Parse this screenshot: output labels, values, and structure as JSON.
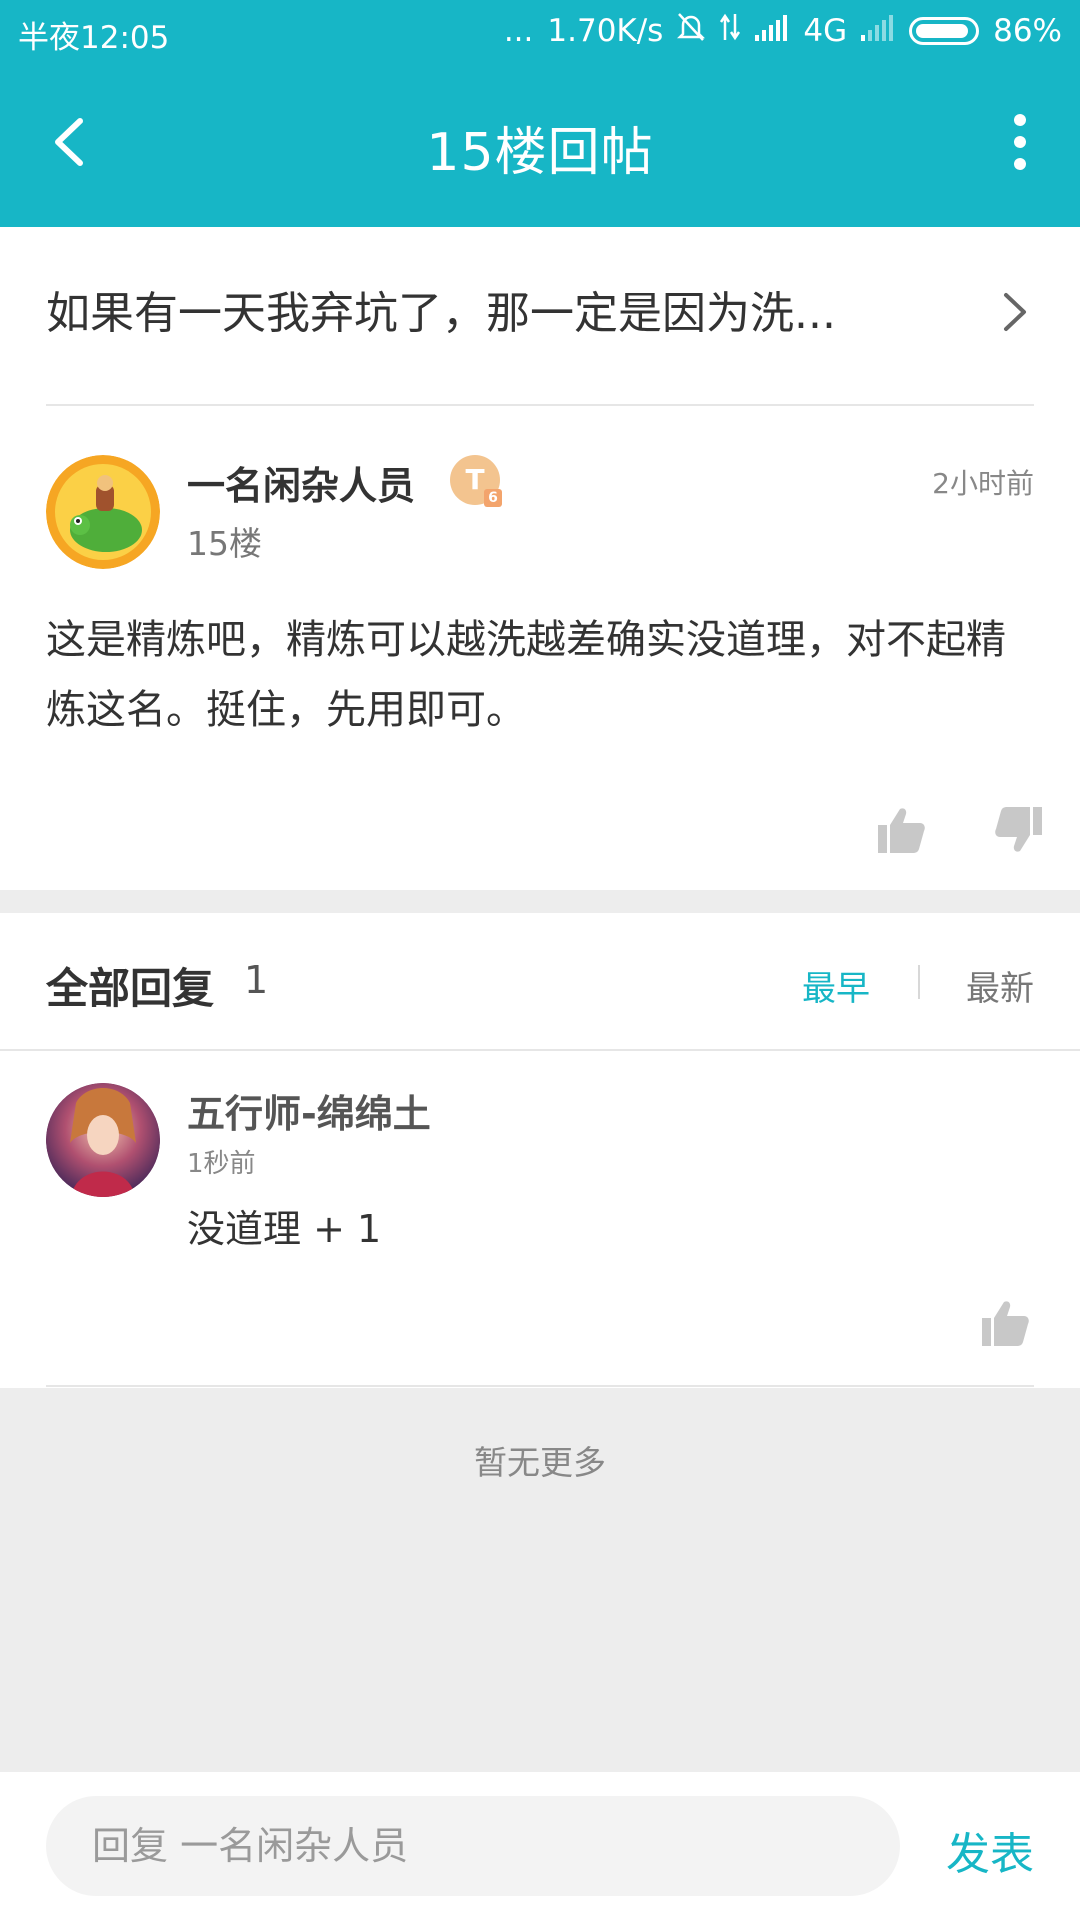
{
  "status_bar": {
    "time": "半夜12:05",
    "dots": "...",
    "net_speed": "1.70K/s",
    "network": "4G",
    "battery": "86%"
  },
  "header": {
    "title": "15楼回帖"
  },
  "thread": {
    "title": "如果有一天我弃坑了，那一定是因为洗..."
  },
  "post": {
    "author": "一名闲杂人员",
    "level_badge": "T",
    "level_sub": "6",
    "floor": "15楼",
    "time": "2小时前",
    "body": "这是精炼吧，精炼可以越洗越差确实没道理，对不起精炼这名。挺住，先用即可。"
  },
  "replies": {
    "title": "全部回复",
    "count": "1",
    "sort_earliest": "最早",
    "sort_latest": "最新",
    "items": [
      {
        "author": "五行师-绵绵土",
        "time": "1秒前",
        "text": "没道理 + 1"
      }
    ],
    "no_more": "暂无更多"
  },
  "footer": {
    "input_placeholder": "回复 一名闲杂人员",
    "publish_label": "发表"
  },
  "colors": {
    "accent": "#17b6c6",
    "badge": "#f3c48f"
  }
}
